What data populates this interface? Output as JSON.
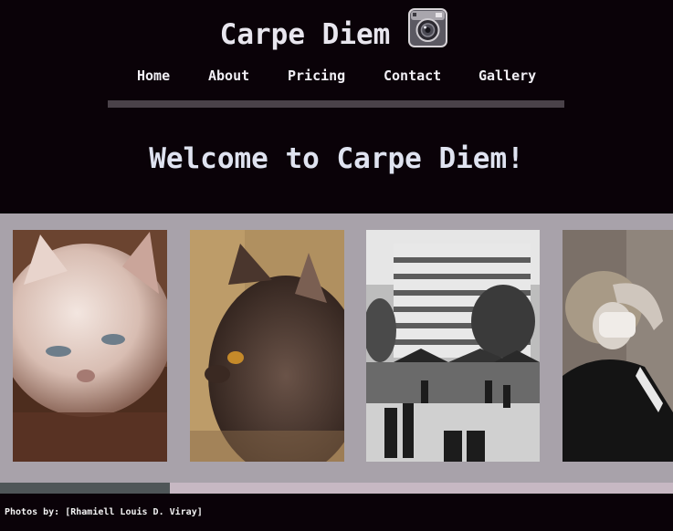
{
  "header": {
    "site_title": "Carpe Diem",
    "logo_icon": "camera-icon"
  },
  "nav": {
    "items": [
      {
        "label": "Home"
      },
      {
        "label": "About"
      },
      {
        "label": "Pricing"
      },
      {
        "label": "Contact"
      },
      {
        "label": "Gallery"
      }
    ]
  },
  "hero": {
    "heading": "Welcome to Carpe Diem!"
  },
  "gallery": {
    "photos": [
      {
        "subject": "white kitten"
      },
      {
        "subject": "tabby cat"
      },
      {
        "subject": "city street market black and white"
      },
      {
        "subject": "portrait of person with hand on face"
      }
    ],
    "scroll_fraction_visible": 0.25
  },
  "footer": {
    "credits": "Photos by: [Rhamiell Louis D. Viray]"
  },
  "colors": {
    "page_background": "#0a0208",
    "gallery_background": "#a8a2aa",
    "text": "#f1eff5",
    "nav_rule": "#4a4249"
  }
}
